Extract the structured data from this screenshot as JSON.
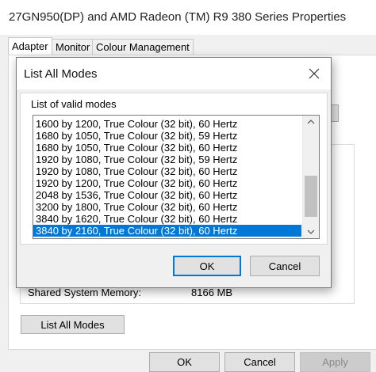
{
  "window": {
    "title": "27GN950(DP) and AMD Radeon (TM) R9 380 Series Properties"
  },
  "tabs": [
    {
      "label": "Adapter",
      "active": true
    },
    {
      "label": "Monitor",
      "active": false
    },
    {
      "label": "Colour Management",
      "active": false
    }
  ],
  "adapter": {
    "shared_memory_label": "Shared System Memory:",
    "shared_memory_value": "8166 MB",
    "list_all_modes_label": "List All Modes"
  },
  "footer": {
    "ok_label": "OK",
    "cancel_label": "Cancel",
    "apply_label": "Apply"
  },
  "dialog": {
    "title": "List All Modes",
    "group_label": "List of valid modes",
    "modes": [
      "1600 by 1200, True Colour (32 bit), 60 Hertz",
      "1680 by 1050, True Colour (32 bit), 59 Hertz",
      "1680 by 1050, True Colour (32 bit), 60 Hertz",
      "1920 by 1080, True Colour (32 bit), 59 Hertz",
      "1920 by 1080, True Colour (32 bit), 60 Hertz",
      "1920 by 1200, True Colour (32 bit), 60 Hertz",
      "2048 by 1536, True Colour (32 bit), 60 Hertz",
      "3200 by 1800, True Colour (32 bit), 60 Hertz",
      "3840 by 1620, True Colour (32 bit), 60 Hertz",
      "3840 by 2160, True Colour (32 bit), 60 Hertz"
    ],
    "selected_index": 9,
    "ok_label": "OK",
    "cancel_label": "Cancel"
  },
  "colors": {
    "accent": "#0078d7",
    "selection_text": "#ffffff"
  }
}
